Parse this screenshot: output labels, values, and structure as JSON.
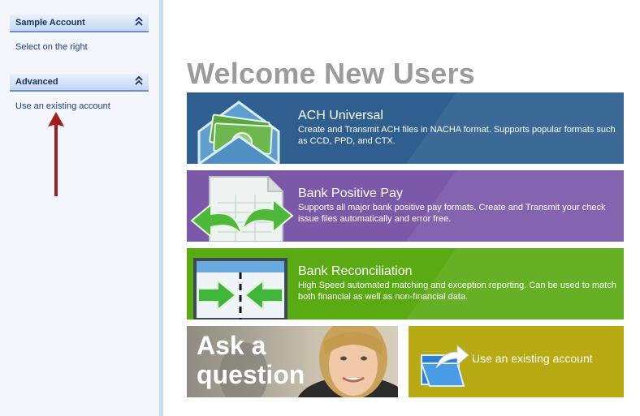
{
  "sidebar": {
    "panels": [
      {
        "title": "Sample Account",
        "link": "Select on the right"
      },
      {
        "title": "Advanced",
        "link": "Use an existing account"
      }
    ],
    "collapse_glyph": "⌃⌃",
    "arrow_color": "#a31d1d"
  },
  "main": {
    "title": "Welcome New Users",
    "tiles": [
      {
        "title": "ACH Universal",
        "description": "Create and Transmit ACH files in NACHA format. Supports popular formats such as CCD, PPD, and CTX.",
        "color": "#2e5f8f",
        "icon": "money-envelope-icon"
      },
      {
        "title": "Bank Positive Pay",
        "description": "Supports all major bank positive pay formats. Create and Transmit your check issue files automatically and error free.",
        "color": "#7b59a8",
        "icon": "document-arrows-icon"
      },
      {
        "title": "Bank Reconciliation",
        "description": "High Speed automated matching and exception reporting. Can be used to match both financial as well as non-financial data.",
        "color": "#5aaa14",
        "icon": "match-arrows-icon"
      }
    ],
    "ask": {
      "label": "Ask a question"
    },
    "existing": {
      "label": "Use an existing account",
      "color": "#b8aa12",
      "icon": "open-folder-icon"
    }
  }
}
